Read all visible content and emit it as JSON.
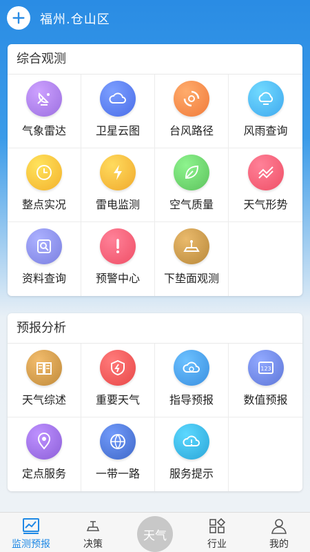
{
  "header": {
    "location": "福州.仓山区"
  },
  "sections": [
    {
      "title": "综合观测",
      "items": [
        {
          "label": "气象雷达",
          "icon": "radar-icon",
          "color": "#9b6fe0"
        },
        {
          "label": "卫星云图",
          "icon": "cloud-icon",
          "color": "#4a6de8"
        },
        {
          "label": "台风路径",
          "icon": "typhoon-icon",
          "color": "#f07a3a"
        },
        {
          "label": "风雨查询",
          "icon": "wind-rain-icon",
          "color": "#3fa8ee"
        },
        {
          "label": "整点实况",
          "icon": "clock-icon",
          "color": "#f3b12b"
        },
        {
          "label": "雷电监测",
          "icon": "lightning-icon",
          "color": "#f0a92c"
        },
        {
          "label": "空气质量",
          "icon": "leaf-icon",
          "color": "#5cc25c"
        },
        {
          "label": "天气形势",
          "icon": "trend-icon",
          "color": "#ef4f66"
        },
        {
          "label": "资料查询",
          "icon": "search-doc-icon",
          "color": "#7a7fe0"
        },
        {
          "label": "预警中心",
          "icon": "alert-icon",
          "color": "#ef4f66"
        },
        {
          "label": "下垫面观测",
          "icon": "surface-icon",
          "color": "#b8883a"
        }
      ]
    },
    {
      "title": "预报分析",
      "items": [
        {
          "label": "天气综述",
          "icon": "book-icon",
          "color": "#c08a3a"
        },
        {
          "label": "重要天气",
          "icon": "shield-icon",
          "color": "#e84848"
        },
        {
          "label": "指导预报",
          "icon": "cloud-clock-icon",
          "color": "#3a8fe0"
        },
        {
          "label": "数值预报",
          "icon": "numeric-icon",
          "color": "#5f77d8"
        },
        {
          "label": "定点服务",
          "icon": "location-pin-icon",
          "color": "#8c5fd8"
        },
        {
          "label": "一带一路",
          "icon": "globe-icon",
          "color": "#3f68c8"
        },
        {
          "label": "服务提示",
          "icon": "cloud-alert-icon",
          "color": "#2aa6d8"
        }
      ]
    }
  ],
  "tabbar": [
    {
      "label": "监测预报",
      "icon": "chart-monitor-icon",
      "active": true
    },
    {
      "label": "决策",
      "icon": "decision-icon",
      "active": false
    },
    {
      "label": "天气",
      "icon": "weather-logo-icon",
      "center": true
    },
    {
      "label": "行业",
      "icon": "grid-shapes-icon",
      "active": false
    },
    {
      "label": "我的",
      "icon": "user-icon",
      "active": false
    }
  ],
  "colors": {
    "header_blue": "#2a8ce4",
    "active_tab": "#1e88e5"
  }
}
